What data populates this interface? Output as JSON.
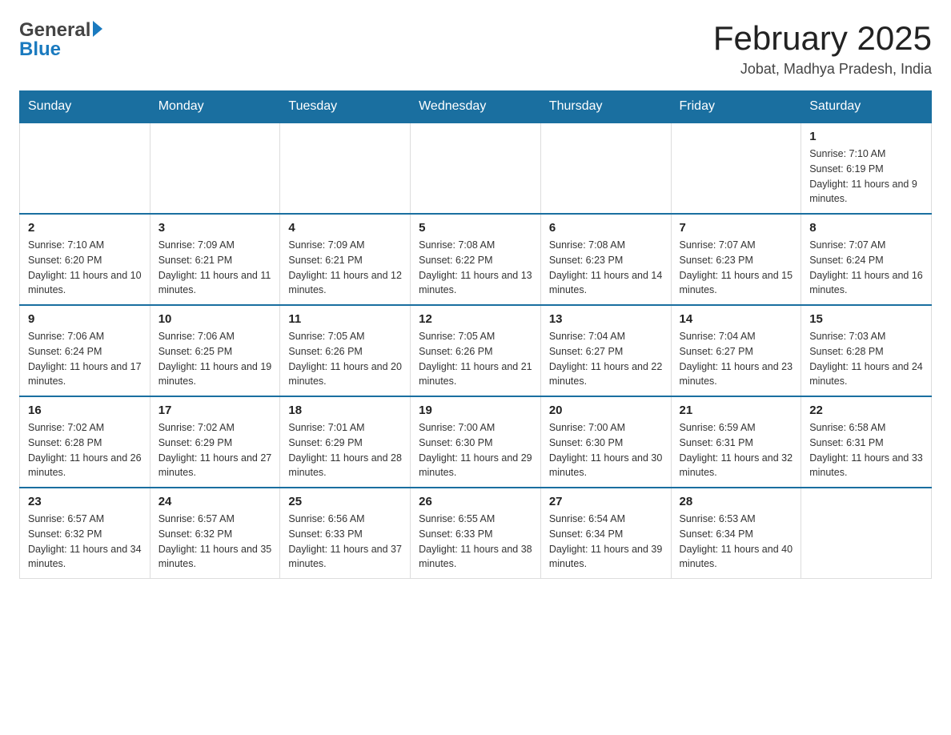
{
  "header": {
    "title": "February 2025",
    "location": "Jobat, Madhya Pradesh, India",
    "logo_general": "General",
    "logo_blue": "Blue"
  },
  "days_of_week": [
    "Sunday",
    "Monday",
    "Tuesday",
    "Wednesday",
    "Thursday",
    "Friday",
    "Saturday"
  ],
  "weeks": [
    [
      {
        "day": "",
        "info": ""
      },
      {
        "day": "",
        "info": ""
      },
      {
        "day": "",
        "info": ""
      },
      {
        "day": "",
        "info": ""
      },
      {
        "day": "",
        "info": ""
      },
      {
        "day": "",
        "info": ""
      },
      {
        "day": "1",
        "info": "Sunrise: 7:10 AM\nSunset: 6:19 PM\nDaylight: 11 hours and 9 minutes."
      }
    ],
    [
      {
        "day": "2",
        "info": "Sunrise: 7:10 AM\nSunset: 6:20 PM\nDaylight: 11 hours and 10 minutes."
      },
      {
        "day": "3",
        "info": "Sunrise: 7:09 AM\nSunset: 6:21 PM\nDaylight: 11 hours and 11 minutes."
      },
      {
        "day": "4",
        "info": "Sunrise: 7:09 AM\nSunset: 6:21 PM\nDaylight: 11 hours and 12 minutes."
      },
      {
        "day": "5",
        "info": "Sunrise: 7:08 AM\nSunset: 6:22 PM\nDaylight: 11 hours and 13 minutes."
      },
      {
        "day": "6",
        "info": "Sunrise: 7:08 AM\nSunset: 6:23 PM\nDaylight: 11 hours and 14 minutes."
      },
      {
        "day": "7",
        "info": "Sunrise: 7:07 AM\nSunset: 6:23 PM\nDaylight: 11 hours and 15 minutes."
      },
      {
        "day": "8",
        "info": "Sunrise: 7:07 AM\nSunset: 6:24 PM\nDaylight: 11 hours and 16 minutes."
      }
    ],
    [
      {
        "day": "9",
        "info": "Sunrise: 7:06 AM\nSunset: 6:24 PM\nDaylight: 11 hours and 17 minutes."
      },
      {
        "day": "10",
        "info": "Sunrise: 7:06 AM\nSunset: 6:25 PM\nDaylight: 11 hours and 19 minutes."
      },
      {
        "day": "11",
        "info": "Sunrise: 7:05 AM\nSunset: 6:26 PM\nDaylight: 11 hours and 20 minutes."
      },
      {
        "day": "12",
        "info": "Sunrise: 7:05 AM\nSunset: 6:26 PM\nDaylight: 11 hours and 21 minutes."
      },
      {
        "day": "13",
        "info": "Sunrise: 7:04 AM\nSunset: 6:27 PM\nDaylight: 11 hours and 22 minutes."
      },
      {
        "day": "14",
        "info": "Sunrise: 7:04 AM\nSunset: 6:27 PM\nDaylight: 11 hours and 23 minutes."
      },
      {
        "day": "15",
        "info": "Sunrise: 7:03 AM\nSunset: 6:28 PM\nDaylight: 11 hours and 24 minutes."
      }
    ],
    [
      {
        "day": "16",
        "info": "Sunrise: 7:02 AM\nSunset: 6:28 PM\nDaylight: 11 hours and 26 minutes."
      },
      {
        "day": "17",
        "info": "Sunrise: 7:02 AM\nSunset: 6:29 PM\nDaylight: 11 hours and 27 minutes."
      },
      {
        "day": "18",
        "info": "Sunrise: 7:01 AM\nSunset: 6:29 PM\nDaylight: 11 hours and 28 minutes."
      },
      {
        "day": "19",
        "info": "Sunrise: 7:00 AM\nSunset: 6:30 PM\nDaylight: 11 hours and 29 minutes."
      },
      {
        "day": "20",
        "info": "Sunrise: 7:00 AM\nSunset: 6:30 PM\nDaylight: 11 hours and 30 minutes."
      },
      {
        "day": "21",
        "info": "Sunrise: 6:59 AM\nSunset: 6:31 PM\nDaylight: 11 hours and 32 minutes."
      },
      {
        "day": "22",
        "info": "Sunrise: 6:58 AM\nSunset: 6:31 PM\nDaylight: 11 hours and 33 minutes."
      }
    ],
    [
      {
        "day": "23",
        "info": "Sunrise: 6:57 AM\nSunset: 6:32 PM\nDaylight: 11 hours and 34 minutes."
      },
      {
        "day": "24",
        "info": "Sunrise: 6:57 AM\nSunset: 6:32 PM\nDaylight: 11 hours and 35 minutes."
      },
      {
        "day": "25",
        "info": "Sunrise: 6:56 AM\nSunset: 6:33 PM\nDaylight: 11 hours and 37 minutes."
      },
      {
        "day": "26",
        "info": "Sunrise: 6:55 AM\nSunset: 6:33 PM\nDaylight: 11 hours and 38 minutes."
      },
      {
        "day": "27",
        "info": "Sunrise: 6:54 AM\nSunset: 6:34 PM\nDaylight: 11 hours and 39 minutes."
      },
      {
        "day": "28",
        "info": "Sunrise: 6:53 AM\nSunset: 6:34 PM\nDaylight: 11 hours and 40 minutes."
      },
      {
        "day": "",
        "info": ""
      }
    ]
  ]
}
